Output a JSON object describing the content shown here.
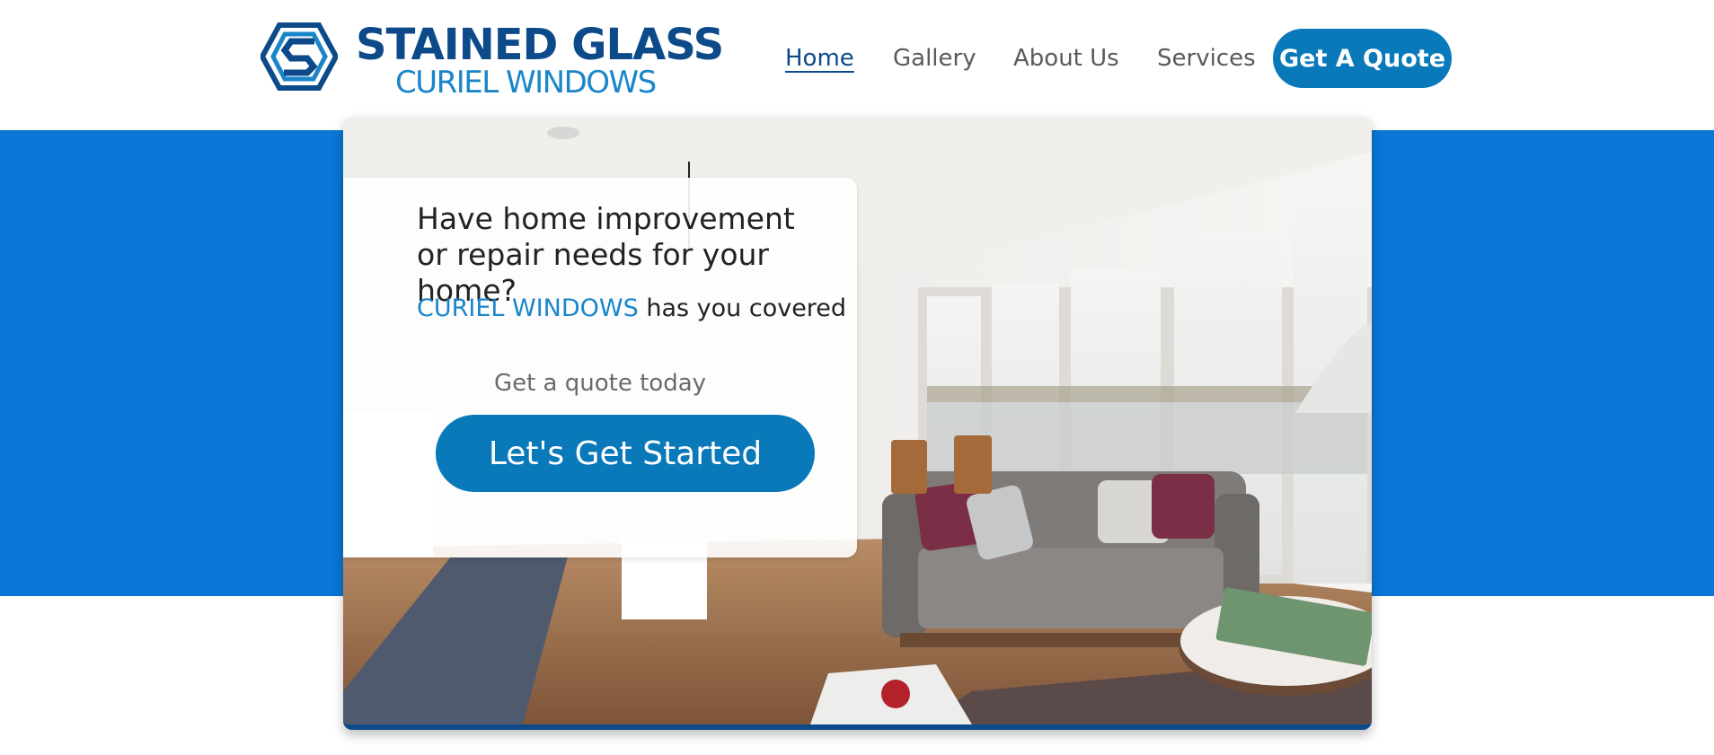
{
  "brand": {
    "title": "STAINED GLASS",
    "subtitle": "CURIEL WINDOWS",
    "logo_icon": "hexagon-s-logo-icon"
  },
  "nav": {
    "items": [
      {
        "label": "Home",
        "active": true
      },
      {
        "label": "Gallery",
        "active": false
      },
      {
        "label": "About Us",
        "active": false
      },
      {
        "label": "Services",
        "active": false
      }
    ],
    "cta_label": "Get A Quote"
  },
  "hero": {
    "image": "living-room-photo",
    "heading": "Have home improvement or repair needs for your home?",
    "tagline_brand": "CURIEL WINDOWS",
    "tagline_rest": " has you covered",
    "quote_prompt": "Get a quote today",
    "button_label": "Let's Get Started"
  },
  "colors": {
    "primary_blue": "#0a79b9",
    "band_blue": "#0a76d6",
    "navy": "#0d4a8a",
    "light_blue": "#1a86c9"
  }
}
